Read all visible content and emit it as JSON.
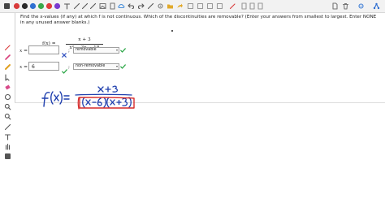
{
  "toolbar": {
    "items": [
      {
        "icon": "square-icon",
        "color": "#444444"
      },
      {
        "icon": "color-dot-icon",
        "color": "#d83a3a"
      },
      {
        "icon": "color-dot-icon",
        "color": "#2a2a2a"
      },
      {
        "icon": "color-dot-icon",
        "color": "#2f6fd1"
      },
      {
        "icon": "color-dot-icon",
        "color": "#3aa84a"
      },
      {
        "icon": "color-dot-icon",
        "color": "#e03a3a"
      },
      {
        "icon": "color-dot-icon",
        "color": "#7a3ad0"
      },
      {
        "icon": "text-icon",
        "color": "#555555"
      },
      {
        "icon": "stroke-icon",
        "color": "#555555"
      },
      {
        "icon": "stroke-icon",
        "color": "#555555"
      },
      {
        "icon": "stroke-icon",
        "color": "#555555"
      },
      {
        "icon": "image-icon",
        "color": "#777777"
      },
      {
        "icon": "pages-icon",
        "color": "#777777"
      },
      {
        "icon": "cloud-icon",
        "color": "#4a90d9"
      },
      {
        "icon": "undo-icon",
        "color": "#555555"
      },
      {
        "icon": "redo-icon",
        "color": "#555555"
      },
      {
        "icon": "line-icon",
        "color": "#555555"
      },
      {
        "icon": "gear-icon",
        "color": "#777777"
      },
      {
        "icon": "folder-icon",
        "color": "#e1a92a"
      },
      {
        "icon": "share-icon",
        "color": "#e1a92a"
      },
      {
        "icon": "grid-icon",
        "color": "#999999"
      },
      {
        "icon": "grid-icon",
        "color": "#999999"
      },
      {
        "icon": "grid-icon",
        "color": "#999999"
      },
      {
        "icon": "grid-icon",
        "color": "#999999"
      },
      {
        "icon": "pen-icon",
        "color": "#d83a3a"
      },
      {
        "icon": "page-icon",
        "color": "#999999"
      },
      {
        "icon": "page-icon",
        "color": "#999999"
      },
      {
        "icon": "page-icon",
        "color": "#999999"
      },
      {
        "icon": "file-icon",
        "color": "#777777"
      },
      {
        "icon": "trash-icon",
        "color": "#777777"
      },
      {
        "icon": "gear-icon",
        "color": "#3a7bd5"
      },
      {
        "icon": "network-icon",
        "color": "#2f6fd1"
      }
    ]
  },
  "sidebar": {
    "tools": [
      {
        "icon": "pen-icon",
        "color": "#d83a3a"
      },
      {
        "icon": "pencil-icon",
        "color": "#d8407a"
      },
      {
        "icon": "highlighter-icon",
        "color": "#e0a020"
      },
      {
        "icon": "pointer-icon",
        "color": "#555555"
      },
      {
        "icon": "eraser-icon",
        "color": "#d84a8a"
      },
      {
        "icon": "shape-icon",
        "color": "#555555"
      },
      {
        "icon": "zoom-icon",
        "color": "#555555"
      },
      {
        "icon": "zoom-icon",
        "color": "#555555"
      },
      {
        "icon": "line-icon",
        "color": "#555555"
      },
      {
        "icon": "text-icon",
        "color": "#555555"
      },
      {
        "icon": "hand-icon",
        "color": "#555555"
      },
      {
        "icon": "square-icon",
        "color": "#555555"
      }
    ]
  },
  "question": {
    "text": "Find the x-values (if any) at which f is not continuous. Which of the discontinuities are removable? (Enter your answers from smallest to largest. Enter NONE in any unused answer blanks.)"
  },
  "formula": {
    "lhs": "f(x) =",
    "numerator": "x + 3",
    "denominator": "x² − 3x − 18"
  },
  "answers": [
    {
      "label": "x",
      "eq": "=",
      "value": "",
      "separator": ";",
      "selection": "removable",
      "value_status": "incorrect",
      "selection_status": "correct"
    },
    {
      "label": "x",
      "eq": "=",
      "value": "6",
      "separator": ";",
      "selection": "non-removable",
      "value_status": "correct",
      "selection_status": "correct"
    }
  ],
  "colors": {
    "correct": "#2fa84a",
    "incorrect": "#2f4fc0",
    "ink": "#1f3fae",
    "highlight": "#d62a2a"
  },
  "handwriting": {
    "lhs": "f(x)=",
    "numerator": "x+3",
    "denominator": "(x-6)(x+3)"
  }
}
